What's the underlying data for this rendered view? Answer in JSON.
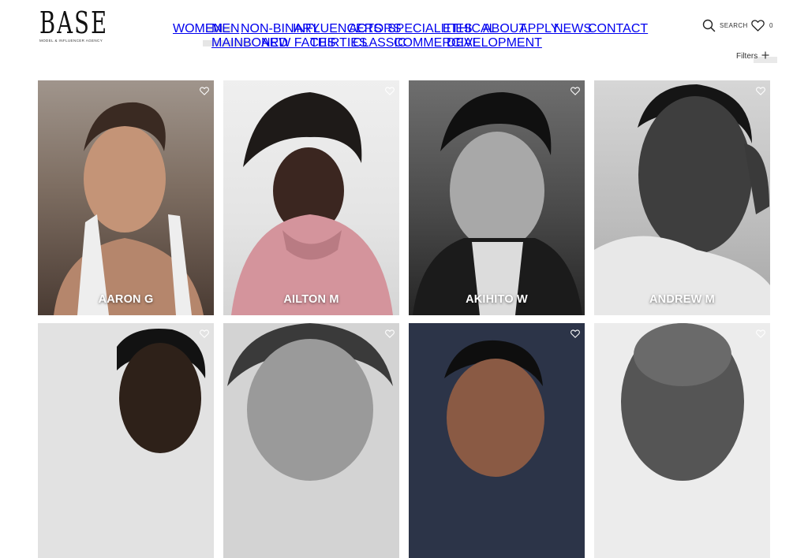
{
  "brand": {
    "name": "BASE",
    "tagline": "MODEL & INFLUENCER AGENCY"
  },
  "nav": {
    "items": [
      "WOMEN",
      "MEN",
      "NON-BINARY",
      "INFLUENCERS",
      "ACTORS",
      "SPECIALITIES",
      "ETHICAL",
      "ABOUT",
      "APPLY",
      "NEWS",
      "CONTACT"
    ],
    "active": "MEN"
  },
  "subnav": {
    "items": [
      "MAINBOARD",
      "NEW FACES",
      "THIRTIES",
      "CLASSIC",
      "COMMERCIAL",
      "DEVELOPMENT"
    ],
    "active": "MAINBOARD"
  },
  "header_actions": {
    "search_label": "SEARCH",
    "favorites_count": "0"
  },
  "filters": {
    "label": "Filters"
  },
  "models": [
    {
      "name": "AARON G",
      "tone": "#8c7d72"
    },
    {
      "name": "AILTON M",
      "tone": "#c98d95"
    },
    {
      "name": "AKIHITO W",
      "tone": "#5a5a5a"
    },
    {
      "name": "ANDREW M",
      "tone": "#9a9a9a"
    },
    {
      "name": "",
      "tone": "#d8d8d8"
    },
    {
      "name": "",
      "tone": "#bdbdbd"
    },
    {
      "name": "",
      "tone": "#2c3448"
    },
    {
      "name": "",
      "tone": "#e4e4e4"
    }
  ],
  "colors": {
    "accent": "#111111",
    "nav_highlight": "#e6e6e6"
  }
}
